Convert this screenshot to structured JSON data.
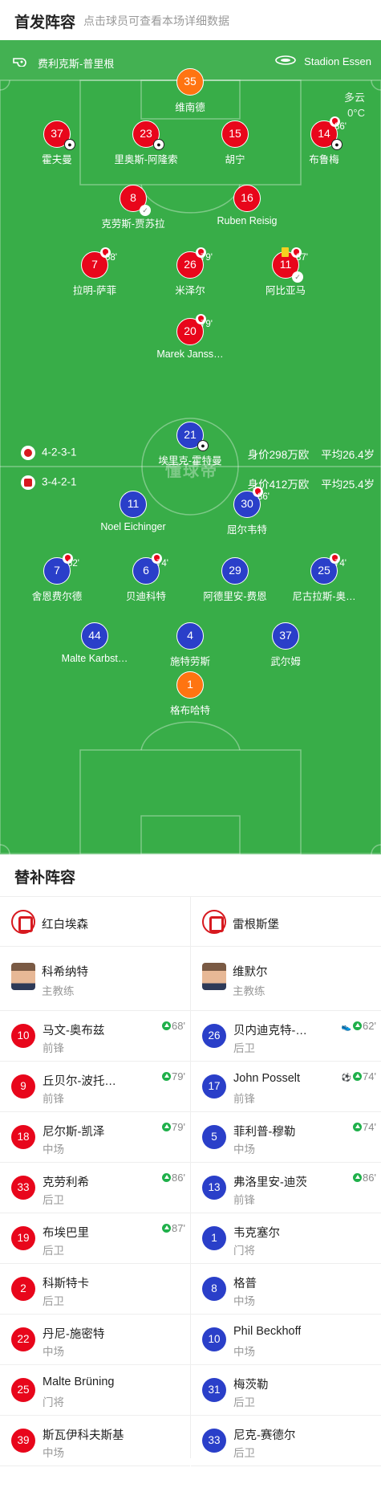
{
  "header": {
    "title": "首发阵容",
    "subtitle": "点击球员可查看本场详细数据"
  },
  "pitch": {
    "referee": "费利克斯-普里根",
    "stadium": "Stadion Essen",
    "weather": "多云",
    "temperature": "0°C",
    "watermark": "懂球帝",
    "home": {
      "formation": "4-2-3-1",
      "value": "身价298万欧",
      "age": "平均26.4岁"
    },
    "away": {
      "formation": "3-4-2-1",
      "value": "身价412万欧",
      "age": "平均25.4岁"
    },
    "players": [
      {
        "num": "35",
        "name": "维南德",
        "color": "orange"
      },
      {
        "num": "37",
        "name": "霍夫曼",
        "color": "red",
        "ball": true
      },
      {
        "num": "23",
        "name": "里奥斯-阿隆索",
        "color": "red",
        "ball": true
      },
      {
        "num": "15",
        "name": "胡宁",
        "color": "red"
      },
      {
        "num": "14",
        "name": "布鲁梅",
        "color": "red",
        "sub": true,
        "min": "86'",
        "ball": true
      },
      {
        "num": "8",
        "name": "克劳斯-贾苏拉",
        "color": "red",
        "shoe": true
      },
      {
        "num": "16",
        "name": "Ruben Reisig",
        "color": "red"
      },
      {
        "num": "7",
        "name": "拉明-萨菲",
        "color": "red",
        "sub": true,
        "min": "68'"
      },
      {
        "num": "26",
        "name": "米泽尔",
        "color": "red",
        "sub": true,
        "min": "79'"
      },
      {
        "num": "11",
        "name": "阿比亚马",
        "color": "red",
        "sub": true,
        "min": "87'",
        "card": true,
        "shoe": true
      },
      {
        "num": "20",
        "name": "Marek Janss…",
        "color": "red",
        "sub": true,
        "min": "79'"
      },
      {
        "num": "21",
        "name": "埃里克-霍特曼",
        "color": "blue",
        "ball": true
      },
      {
        "num": "11",
        "name": "Noel Eichinger",
        "color": "blue"
      },
      {
        "num": "30",
        "name": "屈尔韦特",
        "color": "blue",
        "sub": true,
        "min": "86'"
      },
      {
        "num": "7",
        "name": "舍恩费尔德",
        "color": "blue",
        "sub": true,
        "min": "62'"
      },
      {
        "num": "6",
        "name": "贝迪科特",
        "color": "blue",
        "sub": true,
        "min": "74'"
      },
      {
        "num": "29",
        "name": "阿德里安-费恩",
        "color": "blue"
      },
      {
        "num": "25",
        "name": "尼古拉斯-奥…",
        "color": "blue",
        "sub": true,
        "min": "74'"
      },
      {
        "num": "44",
        "name": "Malte Karbst…",
        "color": "blue"
      },
      {
        "num": "4",
        "name": "施特劳斯",
        "color": "blue"
      },
      {
        "num": "37",
        "name": "武尔姆",
        "color": "blue"
      },
      {
        "num": "1",
        "name": "格布哈特",
        "color": "orange"
      }
    ]
  },
  "subs": {
    "title": "替补阵容",
    "home": {
      "team": "红白埃森",
      "coach": {
        "name": "科希纳特",
        "role": "主教练"
      },
      "players": [
        {
          "num": "10",
          "name": "马文-奥布兹",
          "pos": "前锋",
          "min": "68'"
        },
        {
          "num": "9",
          "name": "丘贝尔-波托…",
          "pos": "前锋",
          "min": "79'"
        },
        {
          "num": "18",
          "name": "尼尔斯-凯泽",
          "pos": "中场",
          "min": "79'"
        },
        {
          "num": "33",
          "name": "克劳利希",
          "pos": "后卫",
          "min": "86'"
        },
        {
          "num": "19",
          "name": "布埃巴里",
          "pos": "后卫",
          "min": "87'"
        },
        {
          "num": "2",
          "name": "科斯特卡",
          "pos": "后卫",
          "min": ""
        },
        {
          "num": "22",
          "name": "丹尼-施密特",
          "pos": "中场",
          "min": ""
        },
        {
          "num": "25",
          "name": "Malte Brüning",
          "pos": "门将",
          "min": ""
        },
        {
          "num": "39",
          "name": "斯瓦伊科夫斯基",
          "pos": "中场",
          "min": ""
        }
      ]
    },
    "away": {
      "team": "雷根斯堡",
      "coach": {
        "name": "维默尔",
        "role": "主教练"
      },
      "players": [
        {
          "num": "26",
          "name": "贝内迪克特-…",
          "pos": "后卫",
          "min": "62'",
          "extra": "shoe"
        },
        {
          "num": "17",
          "name": "John Posselt",
          "pos": "前锋",
          "min": "74'",
          "extra": "ball"
        },
        {
          "num": "5",
          "name": "菲利普-穆勒",
          "pos": "中场",
          "min": "74'"
        },
        {
          "num": "13",
          "name": "弗洛里安-迪茨",
          "pos": "前锋",
          "min": "86'"
        },
        {
          "num": "1",
          "name": "韦克塞尔",
          "pos": "门将",
          "min": ""
        },
        {
          "num": "8",
          "name": "格普",
          "pos": "中场",
          "min": ""
        },
        {
          "num": "10",
          "name": "Phil Beckhoff",
          "pos": "中场",
          "min": ""
        },
        {
          "num": "31",
          "name": "梅茨勒",
          "pos": "后卫",
          "min": ""
        },
        {
          "num": "33",
          "name": "尼克-赛德尔",
          "pos": "后卫",
          "min": ""
        }
      ]
    }
  }
}
